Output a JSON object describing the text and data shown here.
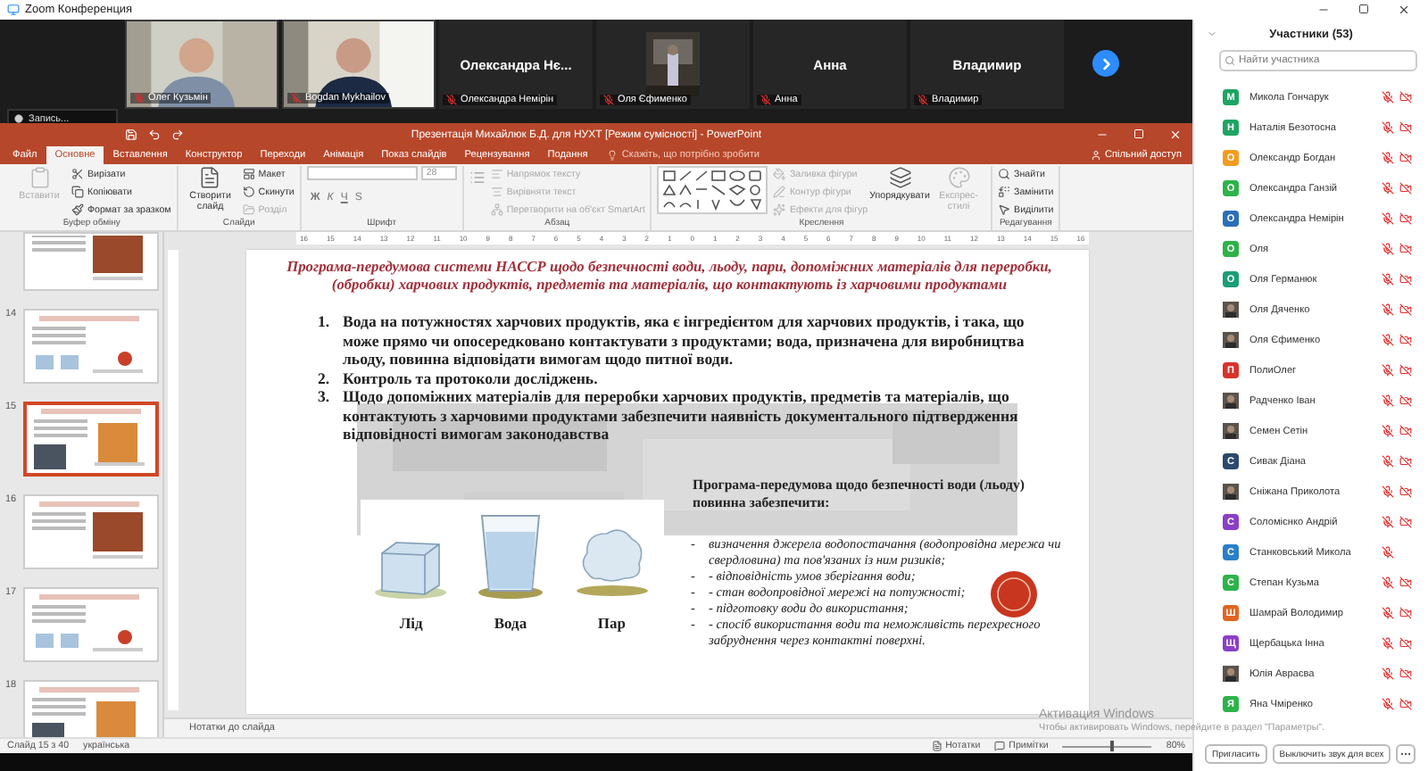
{
  "window": {
    "title": "Zoom Конференция"
  },
  "video_strip": {
    "tiles": [
      {
        "kind": "video",
        "label": "Олег Кузьмін",
        "muted": true
      },
      {
        "kind": "video",
        "label": "Bogdan Mykhailov",
        "muted": true
      },
      {
        "kind": "name",
        "display": "Олександра Нє...",
        "label": "Олександра Немірін",
        "muted": true
      },
      {
        "label": "Оля Єфименко",
        "muted": true
      },
      {
        "kind": "name",
        "display": "Анна",
        "label": "Анна",
        "muted": true
      },
      {
        "kind": "name",
        "display": "Владимир",
        "label": "Владимир",
        "muted": true
      }
    ],
    "recording": "Запись..."
  },
  "powerpoint": {
    "title": "Презентація Михайлюк Б.Д. для НУХТ [Режим сумісності] - PowerPoint",
    "tabs": [
      {
        "label": "Файл",
        "selected": false
      },
      {
        "label": "Основне",
        "selected": true
      },
      {
        "label": "Вставлення",
        "selected": false
      },
      {
        "label": "Конструктор",
        "selected": false
      },
      {
        "label": "Переходи",
        "selected": false
      },
      {
        "label": "Анімація",
        "selected": false
      },
      {
        "label": "Показ слайдів",
        "selected": false
      },
      {
        "label": "Рецензування",
        "selected": false
      },
      {
        "label": "Подання",
        "selected": false
      }
    ],
    "tell_me": {
      "placeholder": "Скажіть, що потрібно зробити"
    },
    "share": "Спільний доступ",
    "ribbon": [
      {
        "label": "Буфер обміну",
        "items": [
          {
            "kind": "large",
            "label": "Вставити",
            "disabled": true
          },
          {
            "kind": "small",
            "label": "Вирізати",
            "disabled": false
          },
          {
            "kind": "small",
            "label": "Копіювати",
            "disabled": false
          },
          {
            "kind": "small",
            "label": "Формат за зразком",
            "disabled": false
          }
        ]
      },
      {
        "label": "Слайди",
        "items": [
          {
            "kind": "large",
            "label": "Створити слайд",
            "disabled": false
          },
          {
            "kind": "small",
            "label": "Макет",
            "disabled": false
          },
          {
            "kind": "small",
            "label": "Скинути",
            "disabled": false
          },
          {
            "kind": "small",
            "label": "Розділ",
            "disabled": true
          }
        ]
      },
      {
        "label": "Шрифт",
        "items": [
          {
            "kind": "font",
            "size": "28",
            "format": [
              "Ж",
              "К",
              "Ч",
              "S"
            ]
          }
        ]
      },
      {
        "label": "Абзац",
        "items": [
          {
            "kind": "lists"
          },
          {
            "kind": "small",
            "label": "Напрямок тексту",
            "disabled": true
          },
          {
            "kind": "small",
            "label": "Вирівняти текст",
            "disabled": true
          },
          {
            "kind": "small",
            "label": "Перетворити на об'єкт SmartArt",
            "disabled": true
          }
        ]
      },
      {
        "label": "Креслення",
        "items": [
          {
            "kind": "shapes"
          },
          {
            "kind": "large",
            "label": "Упорядкувати",
            "disabled": false
          },
          {
            "kind": "large",
            "label": "Експрес-стилі",
            "disabled": true
          },
          {
            "kind": "small",
            "label": "Заливка фігури",
            "disabled": true
          },
          {
            "kind": "small",
            "label": "Контур фігури",
            "disabled": true
          },
          {
            "kind": "small",
            "label": "Ефекти для фігур",
            "disabled": true
          }
        ]
      },
      {
        "label": "Редагування",
        "items": [
          {
            "kind": "small",
            "label": "Знайти",
            "disabled": false
          },
          {
            "kind": "small",
            "label": "Замінити",
            "disabled": false
          },
          {
            "kind": "small",
            "label": "Виділити",
            "disabled": false
          }
        ]
      }
    ],
    "ruler": [
      "16",
      "15",
      "14",
      "13",
      "12",
      "11",
      "10",
      "9",
      "8",
      "7",
      "6",
      "5",
      "4",
      "3",
      "2",
      "1",
      "0",
      "1",
      "2",
      "3",
      "4",
      "5",
      "6",
      "7",
      "8",
      "9",
      "10",
      "11",
      "12",
      "13",
      "14",
      "15",
      "16"
    ],
    "thumbnails": [
      {
        "selected": false
      },
      {
        "number": "14",
        "selected": false
      },
      {
        "number": "15",
        "selected": true
      },
      {
        "number": "16",
        "selected": false
      },
      {
        "number": "17",
        "selected": false
      },
      {
        "number": "18",
        "selected": false
      }
    ],
    "slide": {
      "title": "Програма-передумова системи НАССР щодо безпечності води, льоду, пари, допоміжних матеріалів для переробки, (обробки) харчових продуктів, предметів та матеріалів, що контактують із харчовими продуктами",
      "items": [
        {
          "number": "1.",
          "text": "Вода на потужностях харчових продуктів, яка є інгредієнтом для харчових продуктів, і така, що може прямо чи опосередковано контактувати з продуктами; вода, призначена для виробництва льоду, повинна відповідати вимогам щодо питної води."
        },
        {
          "number": "2.",
          "text": "Контроль та протоколи досліджень."
        },
        {
          "number": "3.",
          "text": "Щодо допоміжних матеріалів для переробки харчових продуктів, предметів та матеріалів, що контактують з харчовими продуктами забезпечити наявність документального підтвердження відповідності вимогам законодавства"
        }
      ],
      "states": [
        {
          "kind": "ice",
          "label": "Лід"
        },
        {
          "kind": "water",
          "label": "Вода"
        },
        {
          "kind": "steam",
          "label": "Пар"
        }
      ],
      "heading": "Програма-передумова щодо безпечності води (льоду) повинна забезпечити:",
      "bullets": [
        {
          "marker": "-",
          "text": "визначення джерела водопостачання (водопровідна мережа чи свердловина) та пов'язаних із ним ризиків;"
        },
        {
          "marker": "-",
          "text": "- відповідність умов зберігання води;"
        },
        {
          "marker": "-",
          "text": "- стан водопровідної мережі на потужності;"
        },
        {
          "marker": "-",
          "text": "- підготовку води до використання;"
        },
        {
          "marker": "-",
          "text": "- спосіб використання води та неможливість перехресного забруднення через контактні поверхні."
        }
      ]
    },
    "notes": "Нотатки до слайда",
    "status": {
      "slide": "Слайд 15 з 40",
      "language": "українська",
      "notes": "Нотатки",
      "comments": "Примітки",
      "zoom_slider": {
        "level": 0.55
      },
      "zoom": "80%"
    }
  },
  "participants": {
    "title": "Участники (53)",
    "search": {
      "placeholder": "Найти участника"
    },
    "list": [
      {
        "kind": "letter",
        "initial": "М",
        "color": "#1fa463",
        "name": "Микола Гончарук",
        "muted": true,
        "video_off": true
      },
      {
        "kind": "letter",
        "initial": "Н",
        "color": "#1fa463",
        "name": "Наталія Безотосна",
        "muted": true,
        "video_off": true
      },
      {
        "kind": "letter",
        "initial": "О",
        "color": "#f29d1f",
        "name": "Олександр Богдан",
        "muted": true,
        "video_off": true
      },
      {
        "kind": "letter",
        "initial": "О",
        "color": "#2db34a",
        "name": "Олександра Ганзій",
        "muted": true,
        "video_off": true
      },
      {
        "kind": "letter",
        "initial": "О",
        "color": "#2a6fb8",
        "name": "Олександра Немірін",
        "muted": true,
        "video_off": true
      },
      {
        "kind": "letter",
        "initial": "О",
        "color": "#2db34a",
        "name": "Оля",
        "muted": true,
        "video_off": true
      },
      {
        "kind": "letter",
        "initial": "О",
        "color": "#1a9e78",
        "name": "Оля Германюк",
        "muted": true,
        "video_off": true
      },
      {
        "name": "Оля Дяченко",
        "muted": true,
        "video_off": true
      },
      {
        "name": "Оля Єфименко",
        "muted": true,
        "video_off": true
      },
      {
        "kind": "letter",
        "initial": "П",
        "color": "#d8322b",
        "name": "ПолиОлег",
        "muted": true,
        "video_off": true
      },
      {
        "name": "Радченко Іван",
        "muted": true,
        "video_off": true
      },
      {
        "name": "Семен Сетін",
        "muted": true,
        "video_off": true
      },
      {
        "kind": "letter",
        "initial": "С",
        "color": "#2b4a6e",
        "name": "Сивак Діана",
        "muted": true,
        "video_off": true
      },
      {
        "name": "Сніжана Приколота",
        "muted": true,
        "video_off": true
      },
      {
        "kind": "letter",
        "initial": "С",
        "color": "#8a3fc7",
        "name": "Соломієнко Андрій",
        "muted": true,
        "video_off": true
      },
      {
        "kind": "letter",
        "initial": "С",
        "color": "#2a7fc9",
        "name": "Станковський Микола",
        "muted": true,
        "video_off": false
      },
      {
        "kind": "letter",
        "initial": "С",
        "color": "#2db34a",
        "name": "Степан Кузьма",
        "muted": true,
        "video_off": true
      },
      {
        "kind": "letter",
        "initial": "Ш",
        "color": "#e0661f",
        "name": "Шамрай Володимир",
        "muted": true,
        "video_off": true
      },
      {
        "kind": "letter",
        "initial": "Щ",
        "color": "#8a3fc7",
        "name": "Щербацька Інна",
        "muted": true,
        "video_off": true
      },
      {
        "name": "Юлія Авраєва",
        "muted": true,
        "video_off": true
      },
      {
        "kind": "letter",
        "initial": "Я",
        "color": "#2db34a",
        "name": "Яна Чміренко",
        "muted": true,
        "video_off": true
      }
    ],
    "buttons": [
      "Пригласить",
      "Выключить звук для всех"
    ]
  },
  "activation": {
    "title": "Активация Windows",
    "text": "Чтобы активировать Windows, перейдите в раздел \"Параметры\"."
  }
}
